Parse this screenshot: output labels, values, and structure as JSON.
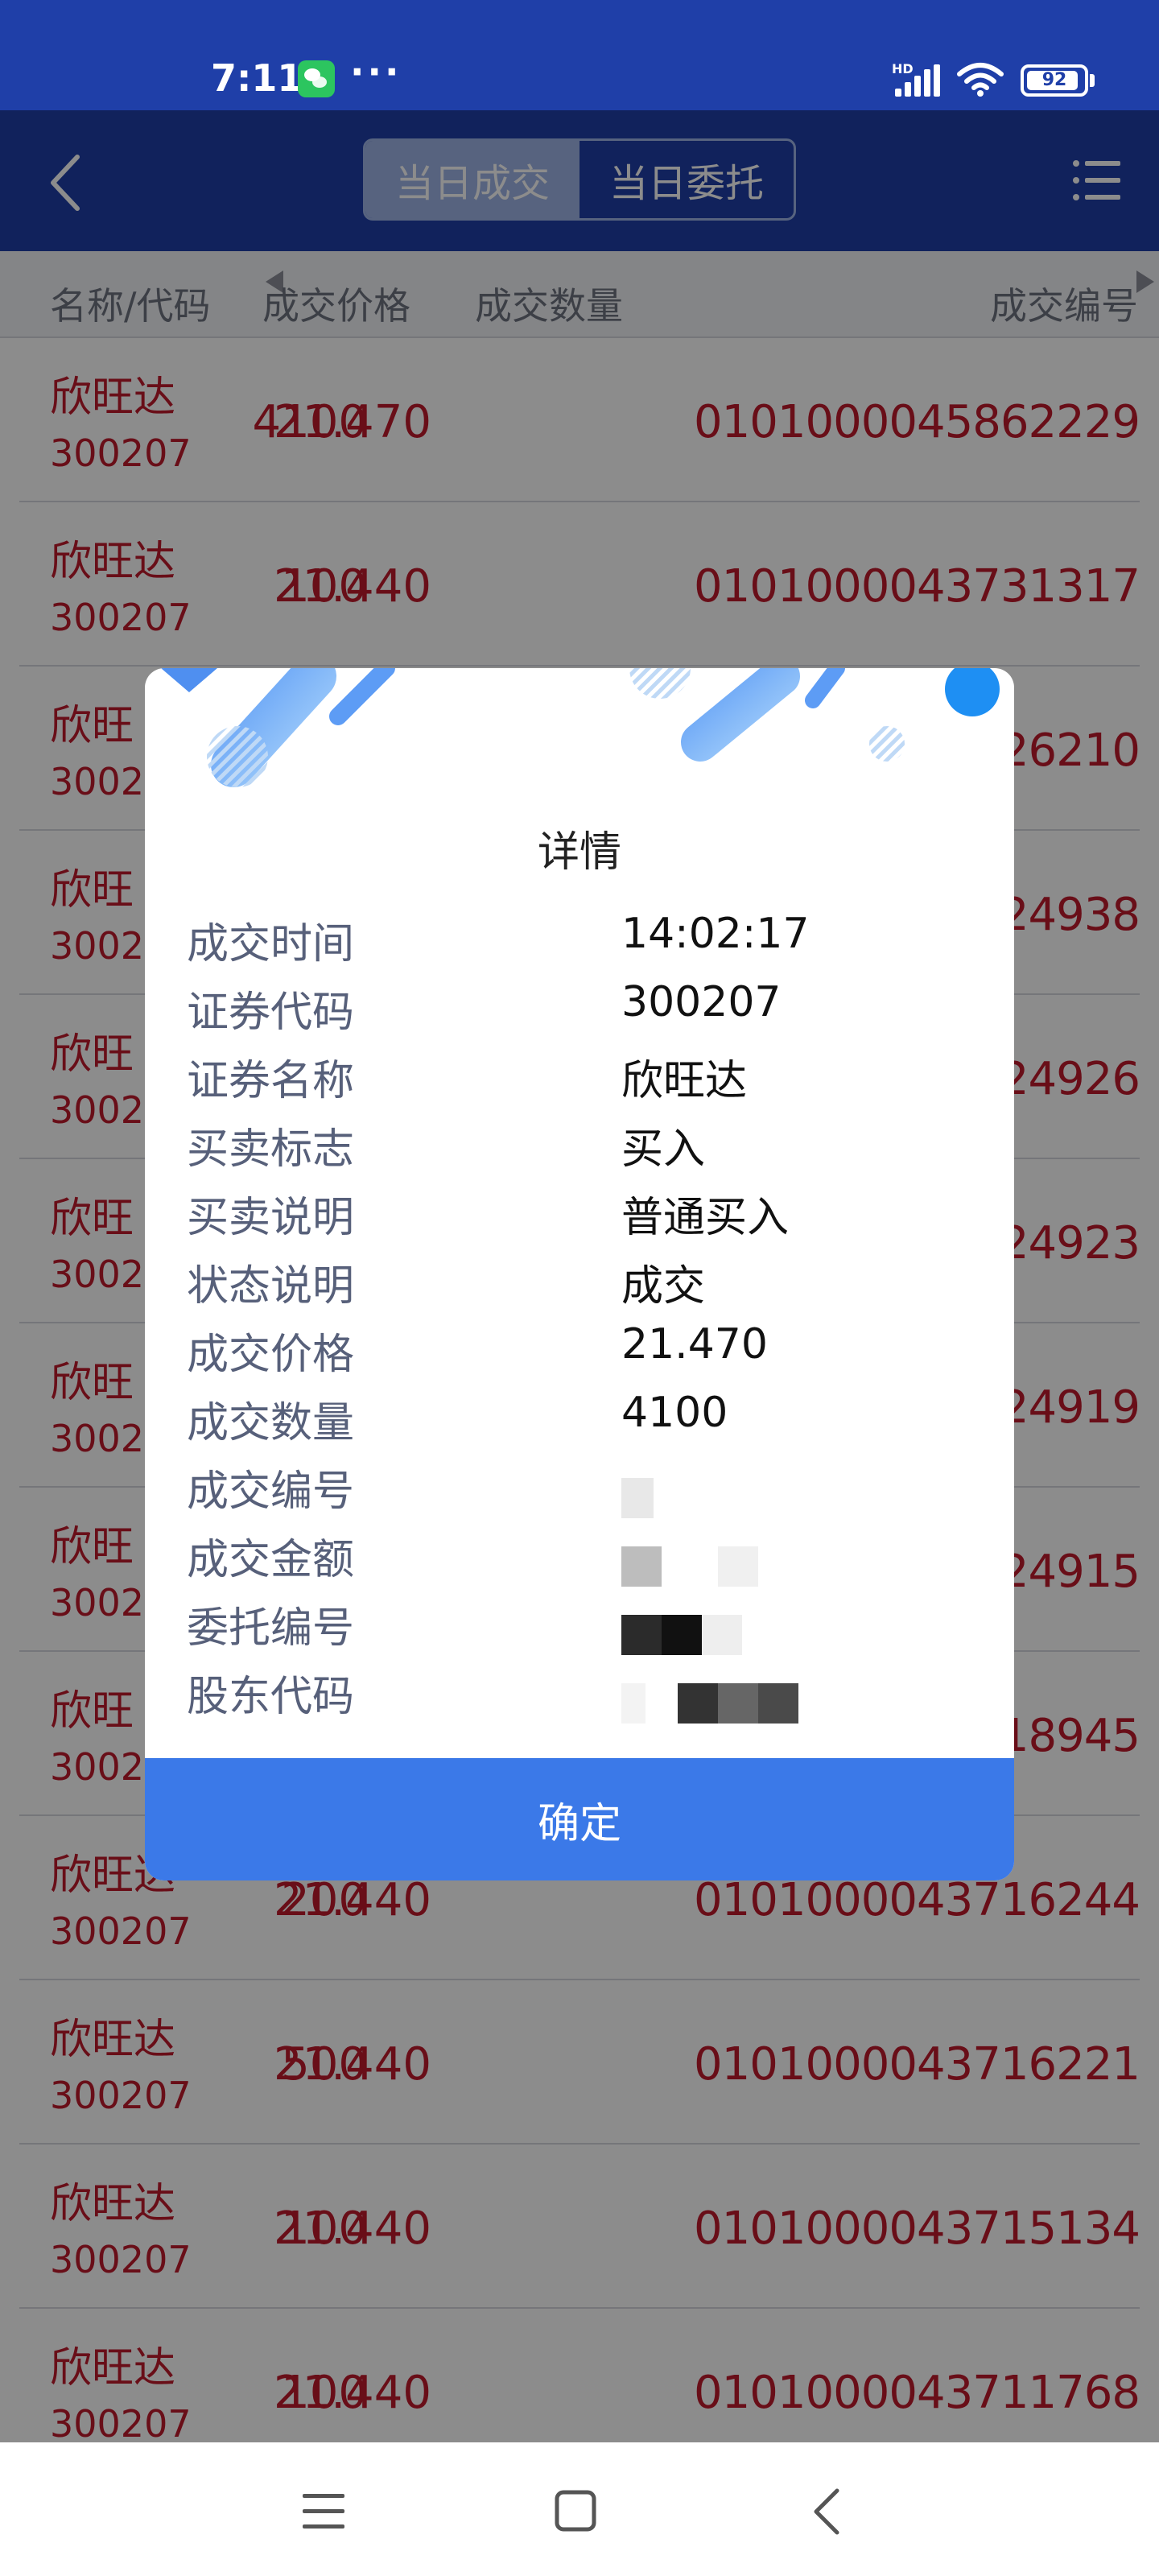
{
  "status_bar": {
    "time": "7:11",
    "more": "···",
    "network": "HD",
    "battery": "92",
    "battery_level": 0.92
  },
  "nav": {
    "tabs": [
      {
        "label": "当日成交",
        "active": true
      },
      {
        "label": "当日委托",
        "active": false
      }
    ]
  },
  "table": {
    "columns": [
      "名称/代码",
      "成交价格",
      "成交数量",
      "成交编号"
    ],
    "rows": [
      {
        "name": "欣旺达",
        "code": "300207",
        "price": "21.470",
        "qty": "4100",
        "id": "0101000045862229"
      },
      {
        "name": "欣旺达",
        "code": "300207",
        "price": "21.440",
        "qty": "100",
        "id": "0101000043731317"
      },
      {
        "name": "欣旺",
        "code": "3002",
        "price": "",
        "qty": "",
        "id": "26210"
      },
      {
        "name": "欣旺",
        "code": "3002",
        "price": "",
        "qty": "",
        "id": "24938"
      },
      {
        "name": "欣旺",
        "code": "3002",
        "price": "",
        "qty": "",
        "id": "24926"
      },
      {
        "name": "欣旺",
        "code": "3002",
        "price": "",
        "qty": "",
        "id": "24923"
      },
      {
        "name": "欣旺",
        "code": "3002",
        "price": "",
        "qty": "",
        "id": "24919"
      },
      {
        "name": "欣旺",
        "code": "3002",
        "price": "",
        "qty": "",
        "id": "24915"
      },
      {
        "name": "欣旺",
        "code": "3002",
        "price": "",
        "qty": "",
        "id": "18945"
      },
      {
        "name": "欣旺达",
        "code": "300207",
        "price": "21.440",
        "qty": "200",
        "id": "0101000043716244"
      },
      {
        "name": "欣旺达",
        "code": "300207",
        "price": "21.440",
        "qty": "500",
        "id": "0101000043716221"
      },
      {
        "name": "欣旺达",
        "code": "300207",
        "price": "21.440",
        "qty": "100",
        "id": "0101000043715134"
      },
      {
        "name": "欣旺达",
        "code": "300207",
        "price": "21.440",
        "qty": "100",
        "id": "0101000043711768"
      }
    ]
  },
  "dialog": {
    "title": "详情",
    "fields": [
      {
        "label": "成交时间",
        "value": "14:02:17"
      },
      {
        "label": "证券代码",
        "value": "300207"
      },
      {
        "label": "证券名称",
        "value": "欣旺达"
      },
      {
        "label": "买卖标志",
        "value": "买入"
      },
      {
        "label": "买卖说明",
        "value": "普通买入"
      },
      {
        "label": "状态说明",
        "value": "成交"
      },
      {
        "label": "成交价格",
        "value": "21.470"
      },
      {
        "label": "成交数量",
        "value": "4100"
      },
      {
        "label": "成交编号",
        "value": ""
      },
      {
        "label": "成交金额",
        "value": ""
      },
      {
        "label": "委托编号",
        "value": ""
      },
      {
        "label": "股东代码",
        "value": ""
      }
    ],
    "confirm_label": "确定"
  },
  "colors": {
    "header_blue": "#1f3fa8",
    "price_red": "#c01a2c",
    "confirm_blue": "#3b79e8",
    "label_gray": "#57607a"
  }
}
